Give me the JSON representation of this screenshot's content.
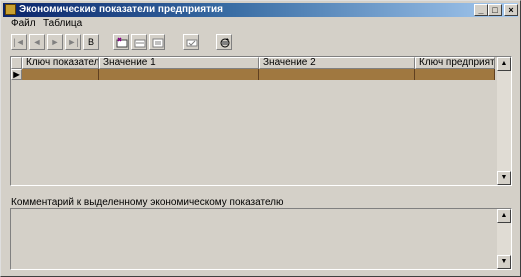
{
  "window": {
    "title": "Экономические показатели предприятия",
    "controls": {
      "minimize": "_",
      "maximize": "□",
      "close": "×"
    }
  },
  "menu": [
    "Файл",
    "Таблица"
  ],
  "toolbar": {
    "nav_buttons": [
      {
        "name": "first-record-button",
        "label": "|◄",
        "icon": "first-icon"
      },
      {
        "name": "prior-record-button",
        "label": "◄",
        "icon": "prior-icon"
      },
      {
        "name": "next-record-button",
        "label": "►",
        "icon": "next-icon"
      },
      {
        "name": "last-record-button",
        "label": "►|",
        "icon": "last-icon"
      },
      {
        "name": "refresh-data-button",
        "label": "В",
        "icon": "letter-icon"
      }
    ]
  },
  "grid": {
    "columns": [
      "Ключ показателя",
      "Значение 1",
      "Значение 2",
      "Ключ предприятия"
    ],
    "rows": [
      [
        "",
        "",
        "",
        ""
      ]
    ],
    "row_indicator": "▶",
    "selected_row_color": "#a07840"
  },
  "comment": {
    "label": "Комментарий к выделенному экономическому показателю",
    "text": ""
  },
  "colors": {
    "face": "#d4d0c8",
    "title_start": "#0a246a",
    "title_end": "#a6caf0"
  }
}
